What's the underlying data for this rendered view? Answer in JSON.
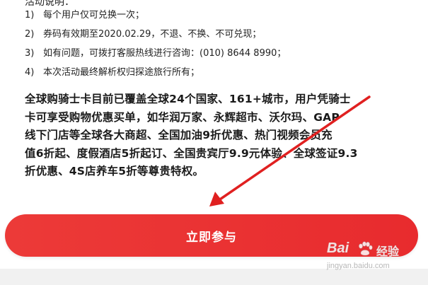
{
  "notes": {
    "title": "活动说明：",
    "rules": [
      {
        "num": "1)",
        "text": "每个用户仅可兑换一次；"
      },
      {
        "num": "2)",
        "text": "券码有效期至2020.02.29，不退、不换、不可兑现；"
      },
      {
        "num": "3)",
        "text": "如有问题，可拨打客服热线进行咨询：(010) 8644 8990；"
      },
      {
        "num": "4)",
        "text": "本次活动最终解析权归探途旅行所有；"
      }
    ]
  },
  "description": {
    "lines": [
      "全球购骑士卡目前已覆盖全球24个国家、161+城市，用户凭骑士",
      "卡可享受购物优惠买单，如华润万家、永辉超市、沃尔玛、GAP",
      "线下门店等全球各大商超、全国加油9折优惠、热门视频会员充",
      "值6折起、度假酒店5折起订、全国贵宾厅9.9元体验、全球签证9.3",
      "折优惠、4S店养车5折等尊贵特权。"
    ]
  },
  "cta": {
    "label": "立即参与"
  },
  "watermark": {
    "brand": "Bai",
    "cn": "经验",
    "url": "jingyan.baidu.com"
  },
  "colors": {
    "cta_background": "#e8312f",
    "arrow": "#e02020"
  },
  "icons": {
    "arrow": "red-arrow-annotation",
    "paw": "baidu-paw-icon"
  }
}
